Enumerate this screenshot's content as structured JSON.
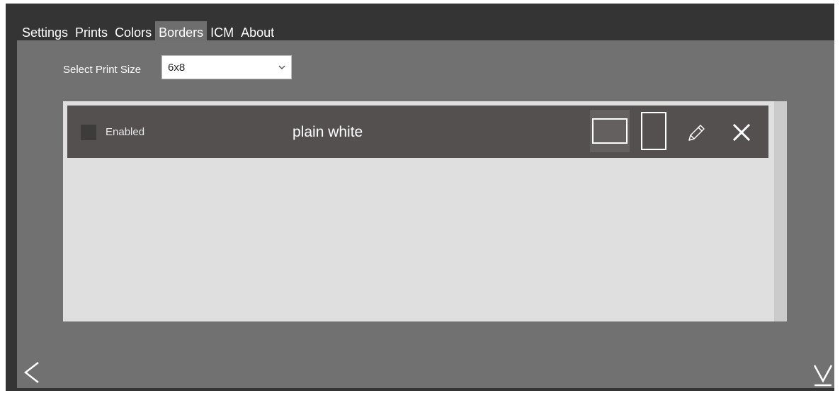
{
  "tabs": [
    {
      "label": "Settings"
    },
    {
      "label": "Prints"
    },
    {
      "label": "Colors"
    },
    {
      "label": "Borders",
      "active": true
    },
    {
      "label": "ICM"
    },
    {
      "label": "About"
    }
  ],
  "print_size": {
    "label": "Select Print Size",
    "value": "6x8"
  },
  "borders": [
    {
      "enabled_label": "Enabled",
      "enabled": false,
      "name": "plain white",
      "selected_orientation": "landscape"
    }
  ],
  "icons": {
    "chevron": "chevron-down-icon",
    "landscape": "landscape-icon",
    "portrait": "portrait-icon",
    "edit": "pencil-icon",
    "delete": "close-icon",
    "back": "back-arrow-icon",
    "download": "download-icon"
  },
  "colors": {
    "frame": "#343434",
    "tab_active": "#6e6e6e",
    "content": "#717171",
    "panel": "#dfdfdf",
    "row": "#545050"
  }
}
